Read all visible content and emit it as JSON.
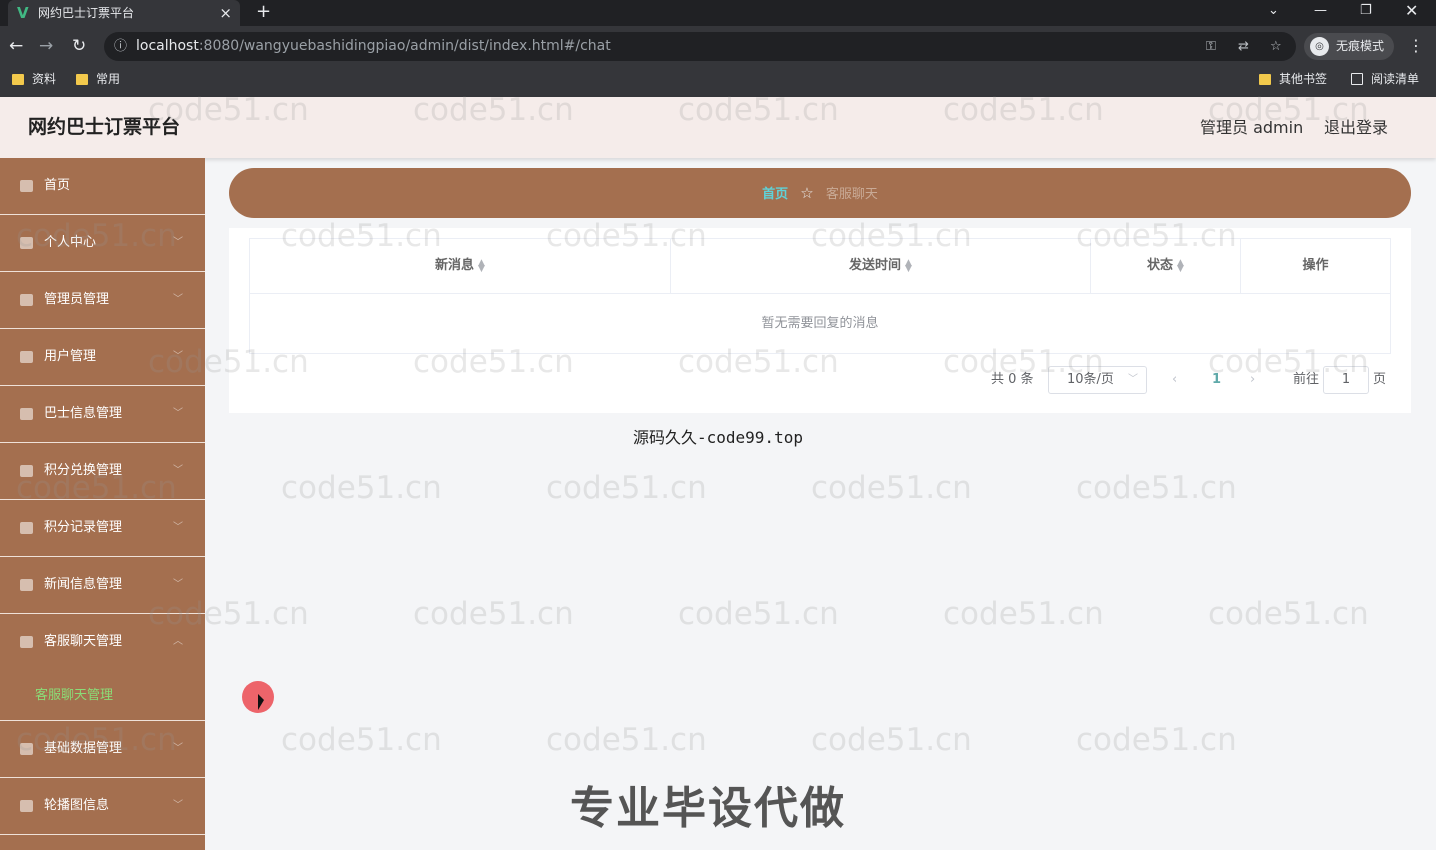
{
  "browser": {
    "tab_title": "网约巴士订票平台",
    "tab_favicon": "V",
    "url_host": "localhost",
    "url_rest": ":8080/wangyuebashidingpiao/admin/dist/index.html#/chat",
    "incognito_label": "无痕模式",
    "bookmarks": [
      "资料",
      "常用"
    ],
    "bookmarks_right": [
      "其他书签",
      "阅读清单"
    ]
  },
  "header": {
    "title": "网约巴士订票平台",
    "admin_label": "管理员 admin",
    "logout": "退出登录"
  },
  "sidebar": {
    "items": [
      {
        "label": "首页"
      },
      {
        "label": "个人中心"
      },
      {
        "label": "管理员管理"
      },
      {
        "label": "用户管理"
      },
      {
        "label": "巴士信息管理"
      },
      {
        "label": "积分兑换管理"
      },
      {
        "label": "积分记录管理"
      },
      {
        "label": "新闻信息管理"
      },
      {
        "label": "客服聊天管理"
      },
      {
        "label": "基础数据管理"
      },
      {
        "label": "轮播图信息"
      }
    ],
    "sub_item": "客服聊天管理"
  },
  "breadcrumb": {
    "home": "首页",
    "current": "客服聊天"
  },
  "table": {
    "columns": [
      "新消息",
      "发送时间",
      "状态",
      "操作"
    ],
    "empty_text": "暂无需要回复的消息"
  },
  "pagination": {
    "total": "共 0 条",
    "page_size": "10条/页",
    "current_page": "1",
    "goto_label": "前往",
    "goto_value": "1",
    "page_unit": "页"
  },
  "overlay": {
    "source_note": "源码久久-code99.top",
    "promo": "专业毕设代做",
    "watermark": "code51.cn"
  },
  "colors": {
    "sidebar_bg": "#a46f4f",
    "header_bg": "#f5ecea",
    "active_sub": "#8bdc77",
    "crumb_home": "#5fd2d8"
  }
}
